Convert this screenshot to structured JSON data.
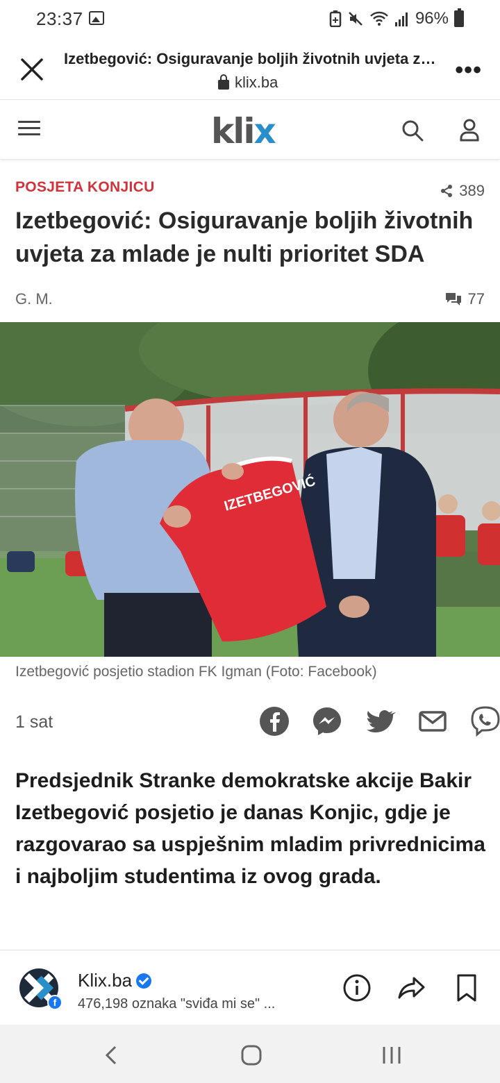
{
  "status_bar": {
    "time": "23:37",
    "battery_percent": "96%"
  },
  "browser": {
    "title": "Izetbegović: Osiguravanje boljih životnih uvjeta za mlade je nulti prioritet SDA",
    "url": "klix.ba"
  },
  "site": {
    "logo_text": "kli",
    "logo_x": "x"
  },
  "article": {
    "category": "POSJETA KONJICU",
    "share_count": "389",
    "headline": "Izetbegović: Osiguravanje boljih životnih uvjeta za mlade je nulti prioritet SDA",
    "author": "G. M.",
    "comment_count": "77",
    "photo_jersey_text": "IZETBEGOVIĆ",
    "caption": "Izetbegović posjetio stadion FK Igman (Foto: Facebook)",
    "time_ago": "1 sat",
    "lead": "Predsjednik Stranke demokratske akcije Bakir Izetbegović posjetio je danas Konjic, gdje je razgovarao sa uspješnim mladim privrednicima i najboljim studentima iz ovog grada."
  },
  "facebook_bar": {
    "page_name": "Klix.ba",
    "likes": "476,198 oznaka \"sviđa mi se\" ..."
  },
  "colors": {
    "category_red": "#d0343a",
    "klix_blue": "#2a8fc9",
    "facebook_blue": "#1877f2"
  }
}
